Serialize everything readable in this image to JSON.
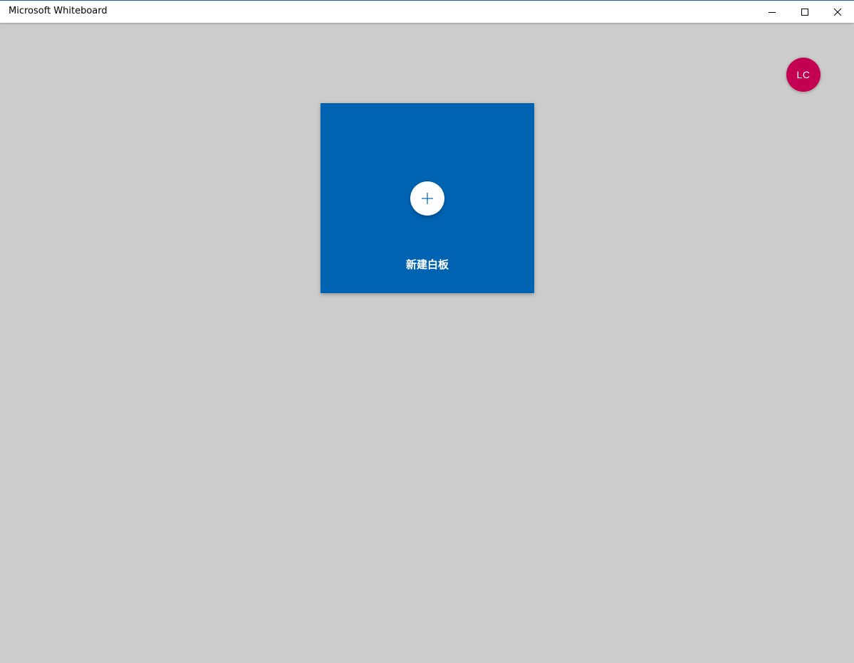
{
  "window": {
    "title": "Microsoft Whiteboard",
    "controls": {
      "minimize": "minimize-icon",
      "maximize": "maximize-icon",
      "close": "close-icon"
    }
  },
  "account": {
    "initials": "LC",
    "color": "#c30052"
  },
  "new_board": {
    "label": "新建白板",
    "icon": "plus-icon",
    "color": "#0063b1"
  },
  "colors": {
    "background": "#cccccc",
    "titlebar": "#ffffff",
    "accent": "#0063b1"
  }
}
